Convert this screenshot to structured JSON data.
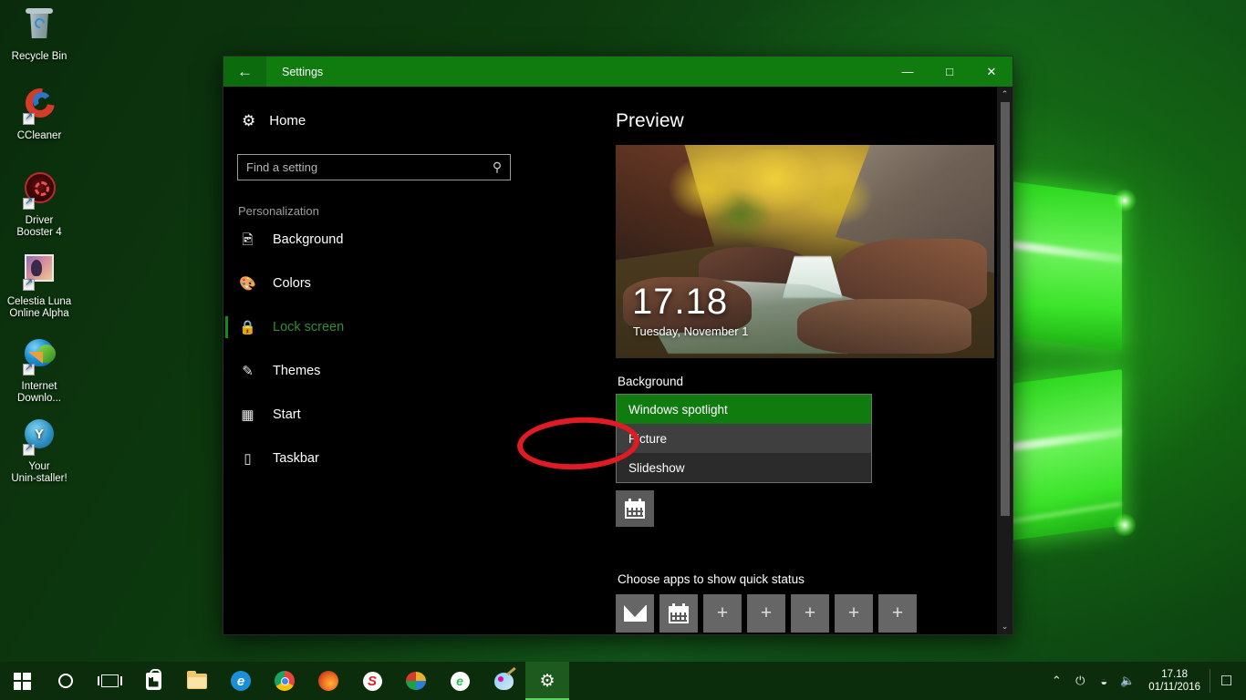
{
  "desktop": {
    "icons": [
      {
        "name": "recycle-bin",
        "label": "Recycle Bin"
      },
      {
        "name": "ccleaner",
        "label": "CCleaner"
      },
      {
        "name": "driver-booster",
        "label": "Driver\nBooster 4"
      },
      {
        "name": "celestia-luna",
        "label": "Celestia Luna\nOnline Alpha"
      },
      {
        "name": "internet-download-manager",
        "label": "Internet\nDownlo..."
      },
      {
        "name": "your-uninstaller",
        "label": "Your\nUnin-staller!"
      }
    ]
  },
  "window": {
    "title": "Settings",
    "back_icon": "back-arrow-icon",
    "minimize_label": "—",
    "maximize_label": "□",
    "close_label": "✕"
  },
  "sidebar": {
    "home_label": "Home",
    "home_icon": "gear-icon",
    "search": {
      "placeholder": "Find a setting",
      "value": "",
      "icon": "search-icon"
    },
    "group_label": "Personalization",
    "items": [
      {
        "label": "Background",
        "icon": "picture-icon",
        "active": false
      },
      {
        "label": "Colors",
        "icon": "palette-icon",
        "active": false
      },
      {
        "label": "Lock screen",
        "icon": "lock-screen-icon",
        "active": true
      },
      {
        "label": "Themes",
        "icon": "brush-icon",
        "active": false
      },
      {
        "label": "Start",
        "icon": "start-tiles-icon",
        "active": false
      },
      {
        "label": "Taskbar",
        "icon": "taskbar-icon",
        "active": false
      }
    ]
  },
  "content": {
    "preview_title": "Preview",
    "preview_clock": "17.18",
    "preview_date": "Tuesday, November 1",
    "background_label": "Background",
    "dropdown": {
      "options": [
        {
          "label": "Windows spotlight",
          "state": "selected"
        },
        {
          "label": "Picture",
          "state": "hover"
        },
        {
          "label": "Slideshow",
          "state": "normal"
        }
      ]
    },
    "detail_status_icon": "calendar-icon",
    "quick_status_label": "Choose apps to show quick status",
    "quick_status_apps": [
      {
        "icon": "mail-icon",
        "label": ""
      },
      {
        "icon": "calendar-icon",
        "label": ""
      },
      {
        "icon": "plus-icon",
        "label": "+"
      },
      {
        "icon": "plus-icon",
        "label": "+"
      },
      {
        "icon": "plus-icon",
        "label": "+"
      },
      {
        "icon": "plus-icon",
        "label": "+"
      },
      {
        "icon": "plus-icon",
        "label": "+"
      }
    ]
  },
  "scrollbar": {
    "up_arrow": "⌃",
    "down_arrow": "⌄"
  },
  "annotation": {
    "shape": "red-ellipse",
    "target": "Picture",
    "color": "#e01b24"
  },
  "taskbar": {
    "items": [
      {
        "name": "start-button",
        "icon": "windows-logo-icon",
        "active": false
      },
      {
        "name": "cortana-button",
        "icon": "cortana-circle-icon",
        "active": false
      },
      {
        "name": "task-view-button",
        "icon": "task-view-icon",
        "active": false
      },
      {
        "name": "microsoft-store",
        "icon": "store-bag-icon",
        "active": false
      },
      {
        "name": "file-explorer",
        "icon": "folder-icon",
        "active": false
      },
      {
        "name": "microsoft-edge",
        "icon": "edge-icon",
        "active": false
      },
      {
        "name": "google-chrome",
        "icon": "chrome-icon",
        "active": false
      },
      {
        "name": "mozilla-firefox",
        "icon": "firefox-icon",
        "active": false
      },
      {
        "name": "smadav",
        "icon": "smadav-icon",
        "active": false
      },
      {
        "name": "internet-download-manager",
        "icon": "idm-icon",
        "active": false
      },
      {
        "name": "evernote",
        "icon": "evernote-icon",
        "active": false
      },
      {
        "name": "paint",
        "icon": "paint-palette-icon",
        "active": false
      },
      {
        "name": "settings",
        "icon": "gear-icon",
        "active": true
      }
    ],
    "tray": {
      "chevron": "⌃",
      "icons": [
        {
          "name": "battery-icon",
          "glyph": "⚡"
        },
        {
          "name": "network-icon",
          "glyph": "◠"
        },
        {
          "name": "volume-icon",
          "glyph": "🔊"
        }
      ],
      "time": "17.18",
      "date": "01/11/2016",
      "action_center_icon": "action-center-icon"
    }
  }
}
